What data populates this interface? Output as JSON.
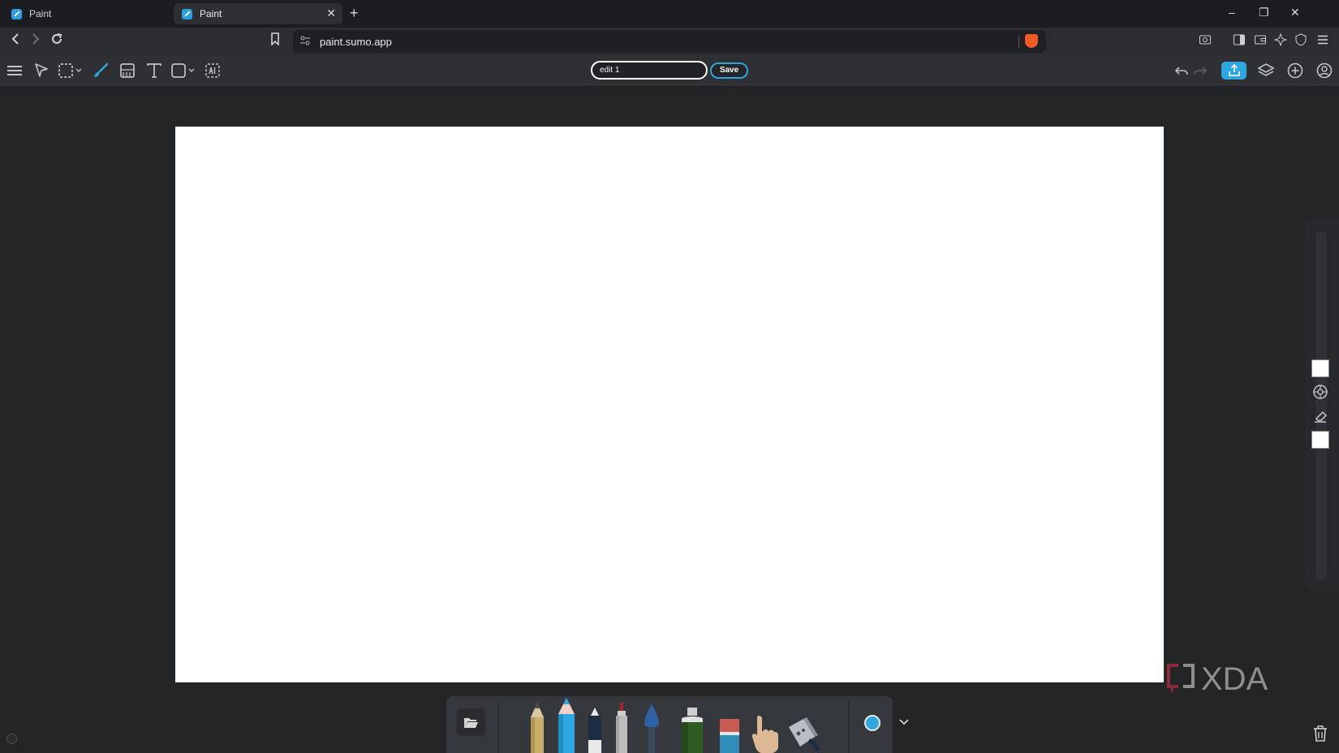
{
  "browser": {
    "tabs": [
      {
        "title": "Paint",
        "active": false
      },
      {
        "title": "Paint",
        "active": true
      }
    ],
    "tab_close_glyph": "✕",
    "new_tab_glyph": "+",
    "window_controls": {
      "minimize": "–",
      "restore": "❐",
      "close": "✕"
    },
    "address": "paint.sumo.app",
    "icons": [
      "back-icon",
      "forward-icon",
      "reload-icon",
      "bookmark-icon",
      "site-settings-icon",
      "brave-shield-icon",
      "screenshot-icon",
      "sidebar-icon",
      "wallet-icon",
      "leo-ai-icon",
      "vpn-icon",
      "menu-icon"
    ]
  },
  "toolbar": {
    "filename_value": "edit 1",
    "save_label": "Save",
    "tools": [
      "menu-icon",
      "select-icon",
      "marquee-icon",
      "brush-icon",
      "pattern-icon",
      "text-icon",
      "shape-icon",
      "ai-icon"
    ],
    "active_tool": "brush-icon",
    "right_icons": [
      "undo-icon",
      "redo-icon",
      "share-icon",
      "layers-icon",
      "add-icon",
      "account-icon"
    ]
  },
  "canvas": {
    "background": "#ffffff"
  },
  "right_panel": {
    "primary_color": "#ffffff",
    "secondary_color": "#ffffff",
    "icons": [
      "color-wheel-icon",
      "eraser-icon"
    ]
  },
  "bottom_toolbox": {
    "brushes": [
      "pencil-icon",
      "colored-pencil-icon",
      "marker-icon",
      "felt-tip-icon",
      "paint-brush-icon",
      "spray-can-icon",
      "eraser-block-icon",
      "smudge-finger-icon",
      "fill-bucket-icon"
    ],
    "selected_brush": "colored-pencil-icon",
    "current_color": "#2ea7e0",
    "brush_size_selector_icon": "chevron-down-icon"
  },
  "watermark": {
    "text": "XDA"
  },
  "accent": "#2ea7e0"
}
